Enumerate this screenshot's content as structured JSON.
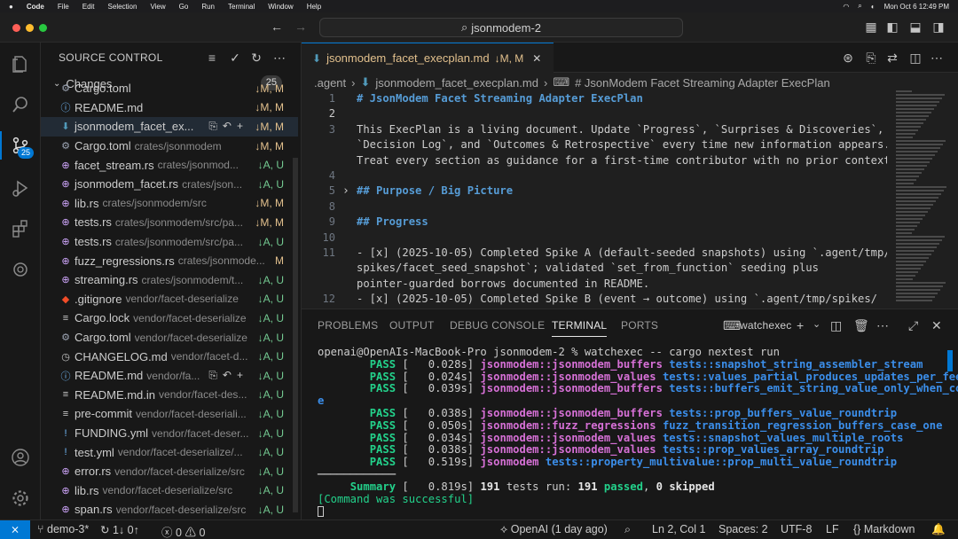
{
  "menubar": {
    "apple": "",
    "items": [
      "Code",
      "File",
      "Edit",
      "Selection",
      "View",
      "Go",
      "Run",
      "Terminal",
      "Window",
      "Help"
    ],
    "datetime": "Mon Oct 6  12:49 PM"
  },
  "titlebar": {
    "search_text": "jsonmodem-2"
  },
  "activity": {
    "scm_badge": "25"
  },
  "sidebar": {
    "title": "SOURCE CONTROL",
    "changes_label": "Changes",
    "changes_count": "25",
    "files": [
      {
        "name": "Cargo.toml",
        "path": "",
        "status": "M, M",
        "icon": "gear-icon",
        "kind": "m"
      },
      {
        "name": "README.md",
        "path": "",
        "status": "M, M",
        "icon": "info-icon",
        "kind": "m"
      },
      {
        "name": "jsonmodem_facet_ex...",
        "path": "",
        "status": "M, M",
        "icon": "markdown-icon",
        "kind": "m",
        "selected": true
      },
      {
        "name": "Cargo.toml",
        "path": "crates/jsonmodem",
        "status": "M, M",
        "icon": "gear-icon",
        "kind": "m"
      },
      {
        "name": "facet_stream.rs",
        "path": "crates/jsonmod...",
        "status": "A, U",
        "icon": "rust-file-icon",
        "kind": "a"
      },
      {
        "name": "jsonmodem_facet.rs",
        "path": "crates/json...",
        "status": "A, U",
        "icon": "rust-file-icon",
        "kind": "a"
      },
      {
        "name": "lib.rs",
        "path": "crates/jsonmodem/src",
        "status": "M, M",
        "icon": "rust-file-icon",
        "kind": "m"
      },
      {
        "name": "tests.rs",
        "path": "crates/jsonmodem/src/pa...",
        "status": "M, M",
        "icon": "rust-file-icon",
        "kind": "m"
      },
      {
        "name": "tests.rs",
        "path": "crates/jsonmodem/src/pa...",
        "status": "A, U",
        "icon": "rust-file-icon",
        "kind": "a"
      },
      {
        "name": "fuzz_regressions.rs",
        "path": "crates/jsonmode...",
        "status": "M",
        "icon": "rust-file-icon",
        "kind": "m"
      },
      {
        "name": "streaming.rs",
        "path": "crates/jsonmodem/t...",
        "status": "A, U",
        "icon": "rust-file-icon",
        "kind": "a"
      },
      {
        "name": ".gitignore",
        "path": "vendor/facet-deserialize",
        "status": "A, U",
        "icon": "git-icon",
        "kind": "a"
      },
      {
        "name": "Cargo.lock",
        "path": "vendor/facet-deserialize",
        "status": "A, U",
        "icon": "lines-file-icon",
        "kind": "a"
      },
      {
        "name": "Cargo.toml",
        "path": "vendor/facet-deserialize",
        "status": "A, U",
        "icon": "gear-icon",
        "kind": "a"
      },
      {
        "name": "CHANGELOG.md",
        "path": "vendor/facet-d...",
        "status": "A, U",
        "icon": "clock-icon",
        "kind": "a"
      },
      {
        "name": "README.md",
        "path": "vendor/fa...",
        "status": "A, U",
        "icon": "info-icon",
        "kind": "a",
        "hover": true
      },
      {
        "name": "README.md.in",
        "path": "vendor/facet-des...",
        "status": "A, U",
        "icon": "lines-file-icon",
        "kind": "a"
      },
      {
        "name": "pre-commit",
        "path": "vendor/facet-deseriali...",
        "status": "A, U",
        "icon": "lines-file-icon",
        "kind": "a"
      },
      {
        "name": "FUNDING.yml",
        "path": "vendor/facet-deser...",
        "status": "A, U",
        "icon": "exclaim-icon",
        "kind": "a"
      },
      {
        "name": "test.yml",
        "path": "vendor/facet-deserialize/...",
        "status": "A, U",
        "icon": "exclaim-icon",
        "kind": "a"
      },
      {
        "name": "error.rs",
        "path": "vendor/facet-deserialize/src",
        "status": "A, U",
        "icon": "rust-file-icon",
        "kind": "a"
      },
      {
        "name": "lib.rs",
        "path": "vendor/facet-deserialize/src",
        "status": "A, U",
        "icon": "rust-file-icon",
        "kind": "a"
      },
      {
        "name": "span.rs",
        "path": "vendor/facet-deserialize/src",
        "status": "A, U",
        "icon": "rust-file-icon",
        "kind": "a"
      }
    ]
  },
  "editor": {
    "tab_name": "jsonmodem_facet_execplan.md",
    "tab_status": "M, M",
    "breadcrumb": [
      ".agent",
      "jsonmodem_facet_execplan.md",
      "# JsonModem Facet Streaming Adapter ExecPlan"
    ],
    "lines": [
      {
        "n": "1",
        "text": "# JsonModem Facet Streaming Adapter ExecPlan"
      },
      {
        "n": "2",
        "text": ""
      },
      {
        "n": "3",
        "text": "This ExecPlan is a living document. Update `Progress`, `Surprises & Discoveries`,"
      },
      {
        "n": "",
        "text": "`Decision Log`, and `Outcomes & Retrospective` every time new information appears."
      },
      {
        "n": "",
        "text": "Treat every section as guidance for a first-time contributor with no prior context."
      },
      {
        "n": "4",
        "text": ""
      },
      {
        "n": "5",
        "text": "## Purpose / Big Picture"
      },
      {
        "n": "8",
        "text": ""
      },
      {
        "n": "9",
        "text": "## Progress"
      },
      {
        "n": "10",
        "text": ""
      },
      {
        "n": "11",
        "text": "- [x] (2025-10-05) Completed Spike A (default-seeded snapshots) using `.agent/tmp/"
      },
      {
        "n": "",
        "text": "spikes/facet_seed_snapshot`; validated `set_from_function` seeding plus"
      },
      {
        "n": "",
        "text": "pointer-guarded borrows documented in README."
      },
      {
        "n": "12",
        "text": "- [x] (2025-10-05) Completed Spike B (event → outcome) using `.agent/tmp/spikes/"
      }
    ]
  },
  "panel": {
    "tabs": [
      "PROBLEMS",
      "OUTPUT",
      "DEBUG CONSOLE",
      "TERMINAL",
      "PORTS"
    ],
    "active_tab": "TERMINAL",
    "terminal_name": "watchexec",
    "prompt": "openai@OpenAIs-MacBook-Pro jsonmodem-2 % watchexec -- cargo nextest run",
    "results": [
      {
        "status": "PASS",
        "time": "[   0.028s]",
        "crate": "jsonmodem::jsonmodem_buffers",
        "test": "tests::snapshot_string_assembler_stream"
      },
      {
        "status": "PASS",
        "time": "[   0.024s]",
        "crate": "jsonmodem::jsonmodem_values",
        "test": "tests::values_partial_produces_updates_per_feed"
      },
      {
        "status": "PASS",
        "time": "[   0.039s]",
        "crate": "jsonmodem::jsonmodem_buffers",
        "test": "tests::buffers_emit_string_value_only_when_complet"
      },
      {
        "status": "PASS",
        "time": "[   0.038s]",
        "crate": "jsonmodem::jsonmodem_buffers",
        "test": "tests::prop_buffers_value_roundtrip"
      },
      {
        "status": "PASS",
        "time": "[   0.050s]",
        "crate": "jsonmodem::fuzz_regressions",
        "test": "fuzz_transition_regression_buffers_case_one"
      },
      {
        "status": "PASS",
        "time": "[   0.034s]",
        "crate": "jsonmodem::jsonmodem_values",
        "test": "tests::snapshot_values_multiple_roots"
      },
      {
        "status": "PASS",
        "time": "[   0.038s]",
        "crate": "jsonmodem::jsonmodem_values",
        "test": "tests::prop_values_array_roundtrip"
      },
      {
        "status": "PASS",
        "time": "[   0.519s]",
        "crate": "jsonmodem",
        "test": "tests::property_multivalue::prop_multi_value_roundtrip"
      }
    ],
    "wrap_char": "e",
    "separator": "────────────",
    "summary_label": "Summary",
    "summary_time": "[   0.819s]",
    "summary_count": "191",
    "summary_mid": "tests run:",
    "summary_count2": "191",
    "summary_passed": "passed",
    "summary_skipped_count": "0",
    "summary_skipped": "skipped",
    "success_msg": "[Command was successful]"
  },
  "statusbar": {
    "remote": "⨯",
    "branch": "demo-3*",
    "sync": "1↓ 0↑",
    "errors": "0",
    "warnings": "0",
    "blame": "OpenAI (1 day ago)",
    "position": "Ln 2, Col 1",
    "spaces": "Spaces: 2",
    "encoding": "UTF-8",
    "eol": "LF",
    "language": "Markdown"
  }
}
